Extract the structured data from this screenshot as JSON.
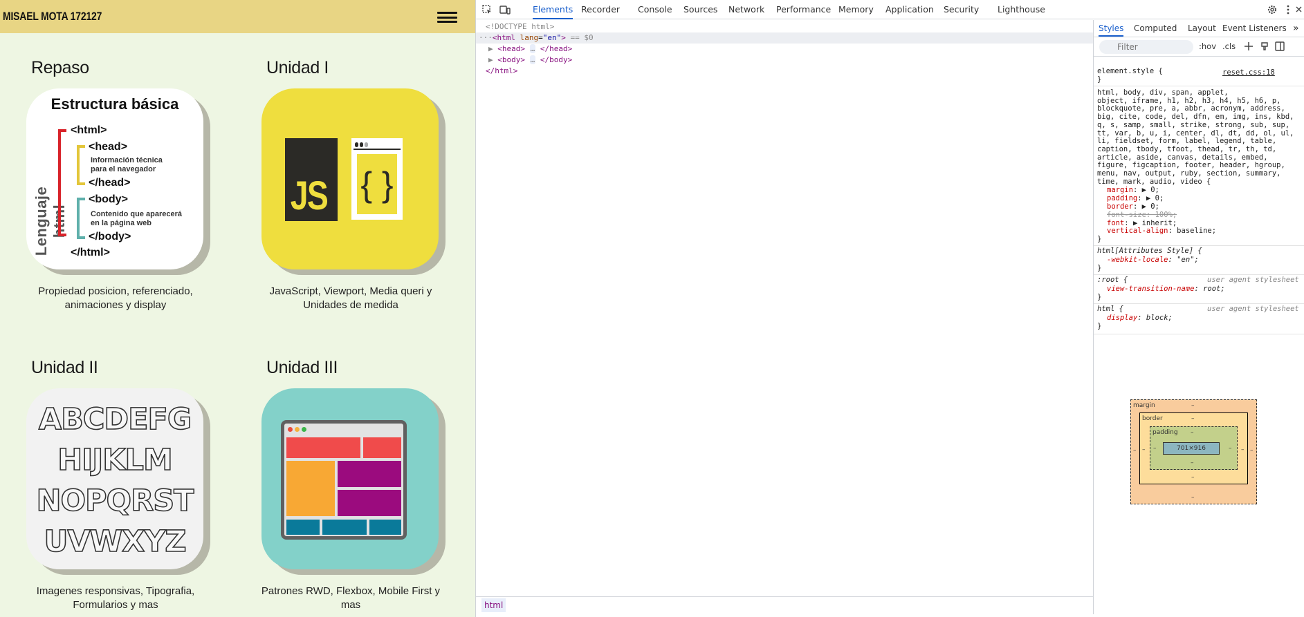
{
  "site": {
    "title": "MISAEL MOTA 172127",
    "menu_icon": "hamburger-menu-icon",
    "cards": [
      {
        "heading": "Repaso",
        "description": "Propiedad posicion, referenciado, animaciones y display"
      },
      {
        "heading": "Unidad I",
        "description": "JavaScript, Viewport, Media queri y Unidades de medida"
      },
      {
        "heading": "Unidad II",
        "description": "Imagenes responsivas, Tipografia, Formularios y mas"
      },
      {
        "heading": "Unidad III",
        "description": "Patrones RWD, Flexbox, Mobile First y mas"
      }
    ],
    "tile1": {
      "heading": "Estructura básica",
      "vertical": "Lenguaje html",
      "html_open": "<html>",
      "head_open": "<head>",
      "head_text_1": "Información técnica",
      "head_text_2": "para el navegador",
      "head_close": "</head>",
      "body_open": "<body>",
      "body_text_1": "Contenido que aparecerá",
      "body_text_2": "en la página web",
      "body_close": "</body>",
      "html_close": "</html>"
    },
    "tile2": {
      "js_label": "JS",
      "braces": "{ }"
    },
    "tile3": {
      "rows": [
        "ABCDEFG",
        "HIJKLM",
        "NOPQRST",
        "UVWXYZ"
      ]
    }
  },
  "devtools": {
    "tabs": [
      "Elements",
      "Recorder",
      "Console",
      "Sources",
      "Network",
      "Performance",
      "Memory",
      "Application",
      "Security",
      "Lighthouse"
    ],
    "active_tab": "Elements",
    "dom": {
      "doctype": "<!DOCTYPE html>",
      "html_open_tag": "<html",
      "html_lang_attr": "lang",
      "html_lang_val": "\"en\"",
      "html_selected_marker": "== $0",
      "head_open": "<head>",
      "head_close": "</head>",
      "body_open": "<body>",
      "body_close": "</body>",
      "html_close": "</html>",
      "ellipsis": "…"
    },
    "breadcrumb": "html",
    "styles": {
      "tabs": [
        "Styles",
        "Computed",
        "Layout",
        "Event Listeners"
      ],
      "active_tab": "Styles",
      "filter_placeholder": "Filter",
      "hov": ":hov",
      "cls": ".cls",
      "element_style": "element.style {",
      "close_brace": "}",
      "reset_source": "reset.css:18",
      "reset_selector": "html, body, div, span, applet,\nobject, iframe, h1, h2, h3, h4, h5, h6, p,\nblockquote, pre, a, abbr, acronym, address,\nbig, cite, code, del, dfn, em, img, ins, kbd,\nq, s, samp, small, strike, strong, sub, sup,\ntt, var, b, u, i, center, dl, dt, dd, ol, ul,\nli, fieldset, form, label, legend, table,\ncaption, tbody, tfoot, thead, tr, th, td,\narticle, aside, canvas, details, embed,\nfigure, figcaption, footer, header, hgroup,\nmenu, nav, output, ruby, section, summary,\ntime, mark, audio, video {",
      "reset_props": [
        {
          "name": "margin",
          "value": "▶ 0;"
        },
        {
          "name": "padding",
          "value": "▶ 0;"
        },
        {
          "name": "border",
          "value": "▶ 0;"
        },
        {
          "name": "font-size",
          "value": "100%;"
        },
        {
          "name": "font",
          "value": "▶ inherit;"
        },
        {
          "name": "vertical-align",
          "value": "baseline;"
        }
      ],
      "attr_style_selector": "html[Attributes Style] {",
      "attr_style_prop": "-webkit-locale",
      "attr_style_val": "\"en\";",
      "root_selector": ":root {",
      "ua_label": "user agent stylesheet",
      "root_prop": "view-transition-name",
      "root_val": "root;",
      "html_selector": "html {",
      "html_prop": "display",
      "html_val": "block;",
      "box_model": {
        "margin": "margin",
        "border": "border",
        "padding": "padding",
        "content": "701×916",
        "dash": "–"
      }
    }
  }
}
